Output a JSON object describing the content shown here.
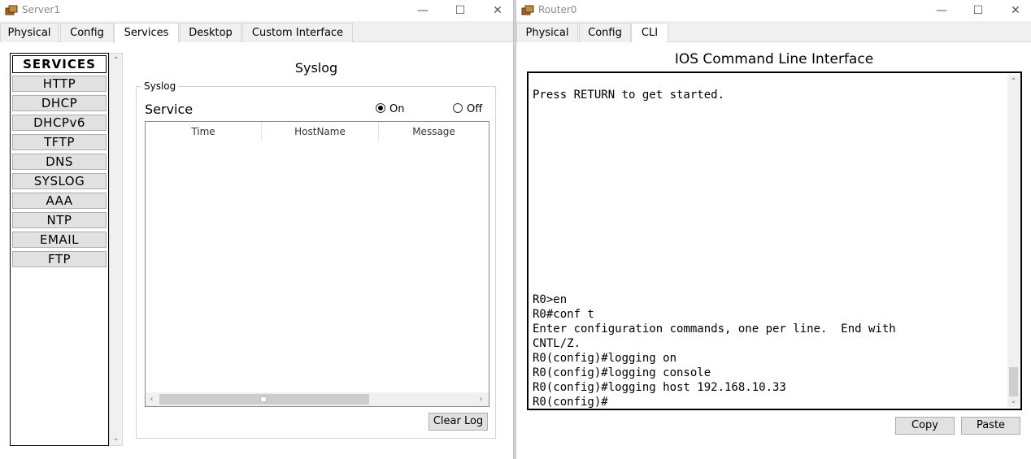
{
  "left_window": {
    "title": "Server1",
    "tabs": [
      "Physical",
      "Config",
      "Services",
      "Desktop",
      "Custom Interface"
    ],
    "active_tab": "Services",
    "services_header": "SERVICES",
    "services": [
      "HTTP",
      "DHCP",
      "DHCPv6",
      "TFTP",
      "DNS",
      "SYSLOG",
      "AAA",
      "NTP",
      "EMAIL",
      "FTP"
    ],
    "panel_title": "Syslog",
    "group_legend": "Syslog",
    "service_label": "Service",
    "radio_on": "On",
    "radio_off": "Off",
    "selected_radio": "On",
    "table_headers": [
      "Time",
      "HostName",
      "Message"
    ],
    "clear_log_label": "Clear Log"
  },
  "right_window": {
    "title": "Router0",
    "tabs": [
      "Physical",
      "Config",
      "CLI"
    ],
    "active_tab": "CLI",
    "cli_title": "IOS Command Line Interface",
    "cli_lines_top": [
      "Press RETURN to get started."
    ],
    "cli_lines_bottom": [
      "R0>en",
      "R0#conf t",
      "Enter configuration commands, one per line.  End with",
      "CNTL/Z.",
      "R0(config)#logging on",
      "R0(config)#logging console",
      "R0(config)#logging host 192.168.10.33",
      "R0(config)#"
    ],
    "copy_label": "Copy",
    "paste_label": "Paste"
  },
  "icons": {
    "app_icon": "packet-tracer-icon",
    "minimize": "minimize-icon",
    "maximize": "maximize-icon",
    "close": "close-icon"
  }
}
